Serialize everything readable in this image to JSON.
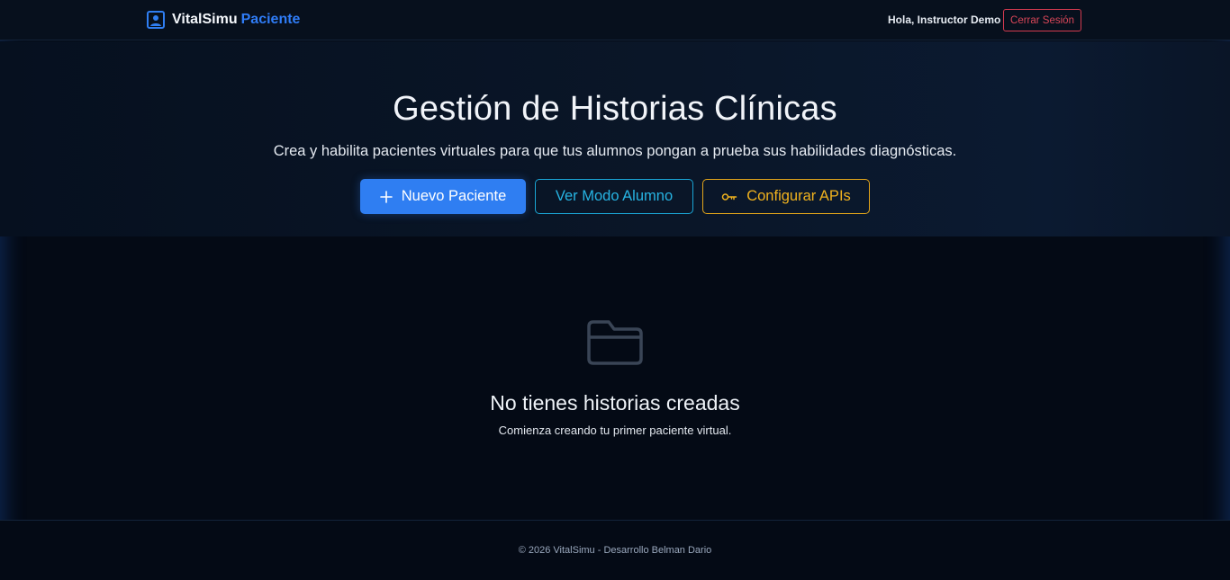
{
  "navbar": {
    "brand_name": "VitalSimu",
    "brand_accent": "Paciente",
    "brand_icon": "user-id-icon",
    "greeting": "Hola, Instructor Demo",
    "logout_label": "Cerrar Sesión"
  },
  "hero": {
    "title": "Gestión de Historias Clínicas",
    "subtitle": "Crea y habilita pacientes virtuales para que tus alumnos pongan a prueba sus habilidades diagnósticas.",
    "buttons": {
      "new_patient": {
        "label": "Nuevo Paciente",
        "icon": "plus-icon"
      },
      "student_mode": {
        "label": "Ver Modo Alumno"
      },
      "configure_apis": {
        "label": "Configurar APIs",
        "icon": "key-icon"
      }
    }
  },
  "empty_state": {
    "icon": "folder-icon",
    "title": "No tienes historias creadas",
    "text": "Comienza creando tu primer paciente virtual."
  },
  "footer": {
    "text": "© 2026 VitalSimu - Desarrollo Belman Dario"
  },
  "colors": {
    "background": "#040a15",
    "primary": "#2f7ef2",
    "info": "#27b4e3",
    "warning": "#f0b21e",
    "danger": "#d84658"
  }
}
